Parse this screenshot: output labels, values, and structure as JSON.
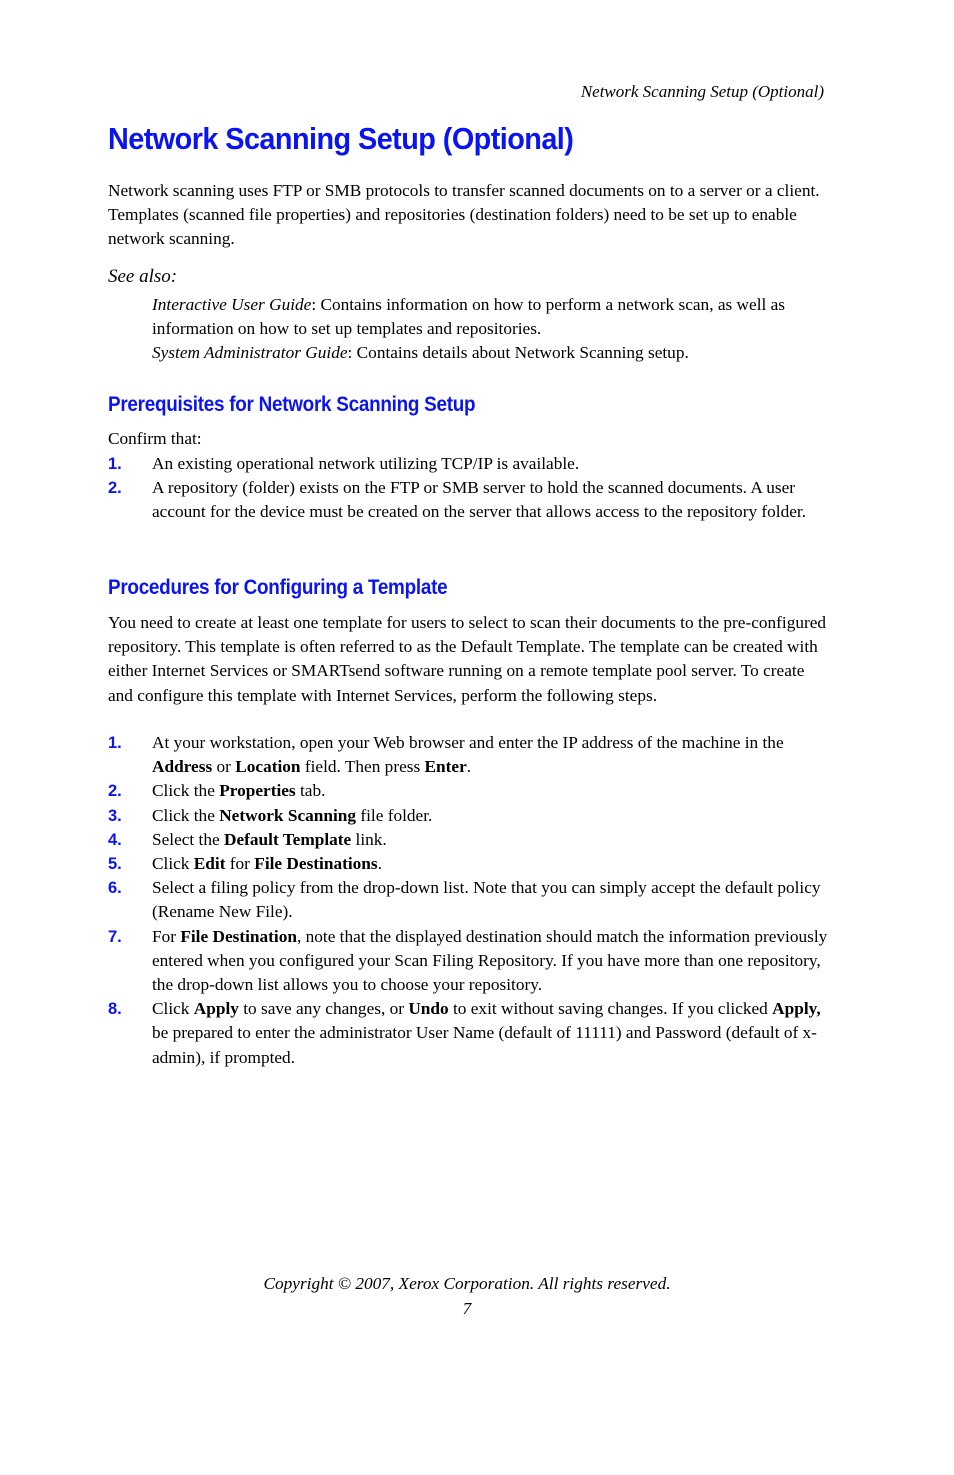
{
  "header": {
    "running_title": "Network Scanning Setup (Optional)"
  },
  "title": "Network Scanning Setup (Optional)",
  "intro": "Network scanning uses FTP or SMB protocols to transfer scanned documents on to a server or a client. Templates (scanned file properties) and repositories (destination folders) need to be set up to enable network scanning.",
  "see_also": {
    "label": "See also:",
    "items": [
      {
        "title": "Interactive User Guide",
        "text": ": Contains information on how to perform a network scan, as well as information on how to set up templates and repositories."
      },
      {
        "title": "System Administrator Guide",
        "text": ": Contains details about Network Scanning setup."
      }
    ]
  },
  "prerequisites": {
    "heading": "Prerequisites for Network Scanning Setup",
    "lead": "Confirm that:",
    "steps": [
      {
        "num": "1.",
        "text": "An existing operational network utilizing TCP/IP is available."
      },
      {
        "num": "2.",
        "text": "A repository (folder) exists on the FTP or SMB server to hold the scanned documents. A user account for the device must be created on the server that allows access to the repository folder."
      }
    ]
  },
  "procedures": {
    "heading": "Procedures for Configuring a Template",
    "intro": "You need to create at least one template for users to select to scan their documents to the pre-configured repository. This template is often referred to as the Default Template. The template can be created with either Internet Services or SMARTsend software running on a remote template pool server. To create and configure this template with Internet Services, perform the following steps.",
    "steps": [
      {
        "num": "1.",
        "parts": [
          "At your workstation, open your Web browser and enter the IP address of the machine in the ",
          "Address",
          " or ",
          "Location",
          " field. Then press ",
          "Enter",
          "."
        ]
      },
      {
        "num": "2.",
        "parts": [
          "Click the ",
          "Properties",
          " tab."
        ]
      },
      {
        "num": "3.",
        "parts": [
          "Click the ",
          "Network Scanning",
          " file folder."
        ]
      },
      {
        "num": "4.",
        "parts": [
          "Select the ",
          "Default Template",
          " link."
        ]
      },
      {
        "num": "5.",
        "parts": [
          "Click ",
          "Edit",
          " for ",
          "File Destinations",
          "."
        ]
      },
      {
        "num": "6.",
        "parts": [
          "Select a filing policy from the drop-down list. Note that you can simply accept the default policy (Rename New File)."
        ]
      },
      {
        "num": "7.",
        "parts": [
          "For ",
          "File Destination",
          ", note that the displayed destination should match the information previously entered when you configured your Scan Filing Repository. If you have more than one repository, the drop-down list allows you to choose your repository."
        ]
      },
      {
        "num": "8.",
        "parts": [
          "Click ",
          "Apply",
          " to save any changes, or ",
          "Undo",
          " to exit without saving changes. If you clicked ",
          "Apply,",
          " be prepared to enter the administrator User Name (default of 11111) and Password (default of x-admin), if prompted."
        ]
      }
    ]
  },
  "footer": {
    "copyright": "Copyright © 2007, Xerox Corporation. All rights reserved.",
    "page_number": "7"
  },
  "colors": {
    "heading": "#0a14f0",
    "text": "#000000"
  }
}
